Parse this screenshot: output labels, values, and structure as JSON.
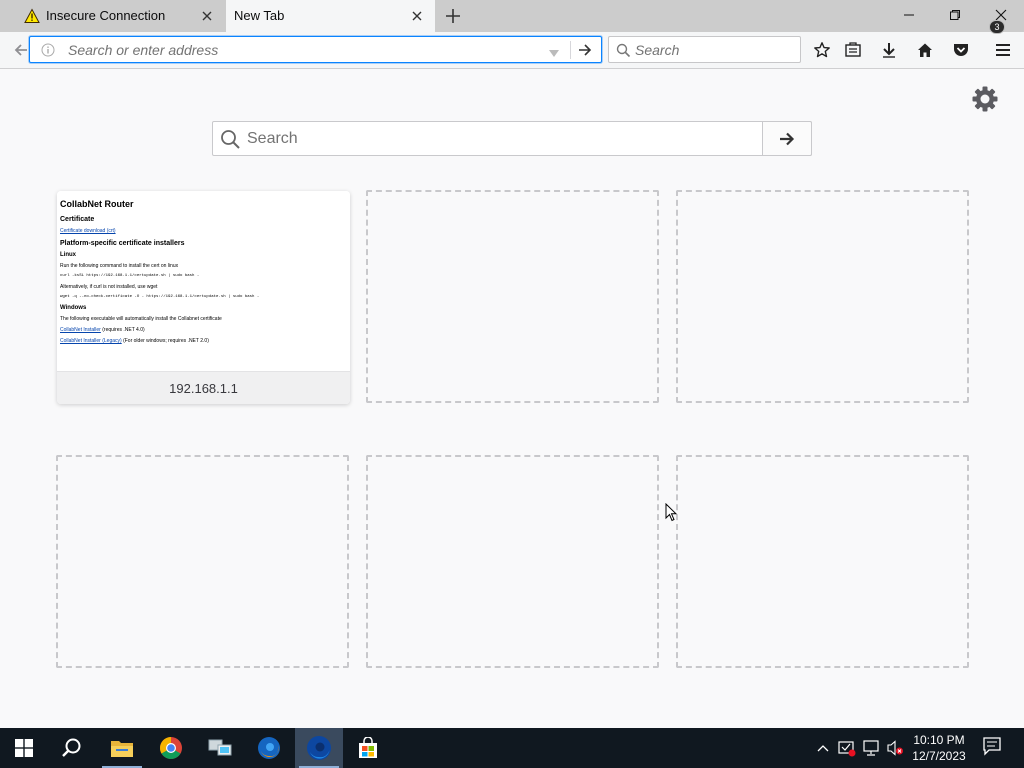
{
  "tabs": [
    {
      "title": "Insecure Connection",
      "icon": "warning-icon",
      "active": false
    },
    {
      "title": "New Tab",
      "icon": "",
      "active": true
    }
  ],
  "navbar": {
    "url_placeholder": "Search or enter address",
    "search_placeholder": "Search",
    "toolbar_icons": [
      "bookmark-star-icon",
      "library-icon",
      "download-icon",
      "home-icon",
      "pocket-icon",
      "hamburger-menu-icon"
    ]
  },
  "newtab": {
    "search_placeholder": "Search",
    "top_sites": [
      {
        "label": "192.168.1.1",
        "preview": {
          "title": "CollabNet Router",
          "certificate_heading": "Certificate",
          "certificate_link": "Certificate download (crt)",
          "installers_heading": "Platform-specific certificate installers",
          "linux_heading": "Linux",
          "linux_text": "Run the following command to install the cert on linux",
          "linux_cmd": "curl -ksSL https://192.168.1.1/certupdate.sh | sudo bash -",
          "linux_alt": "Alternatively, if curl is not installed, use wget",
          "linux_cmd2": "wget -q --no-check-certificate -O - https://192.168.1.1/certupdate.sh | sudo bash -",
          "windows_heading": "Windows",
          "windows_text": "The following executable will automatically install the Collabnet certificate",
          "windows_link1": "CollabNet Installer",
          "windows_link1_note": " (requires .NET 4.0)",
          "windows_link2": "CollabNet Installer (Legacy)",
          "windows_link2_note": " (For older windows; requires .NET 2.0)"
        }
      }
    ]
  },
  "taskbar": {
    "apps": [
      "windows-start-icon",
      "search-icon",
      "file-explorer-icon",
      "chrome-icon",
      "network-app-icon",
      "firefox-icon",
      "firefox-nightly-icon",
      "store-icon"
    ],
    "clock_time": "10:10 PM",
    "clock_date": "12/7/2023",
    "notification_count": "3"
  },
  "colors": {
    "accent": "#0a84ff",
    "taskbar": "#101820",
    "tabstrip": "#cccccc"
  }
}
